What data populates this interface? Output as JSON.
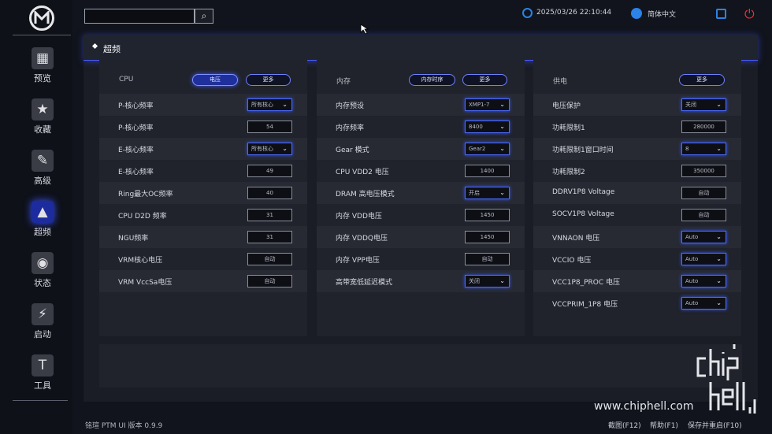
{
  "topbar": {
    "search_placeholder": "",
    "datetime": "2025/03/26 22:10:44",
    "language": "简体中文"
  },
  "sidebar": {
    "items": [
      {
        "label": "预览",
        "icon": "grid-icon"
      },
      {
        "label": "收藏",
        "icon": "star-icon"
      },
      {
        "label": "高级",
        "icon": "tools-icon"
      },
      {
        "label": "超频",
        "icon": "rocket-icon",
        "active": true
      },
      {
        "label": "状态",
        "icon": "eye-icon"
      },
      {
        "label": "启动",
        "icon": "ssd-icon"
      },
      {
        "label": "工具",
        "icon": "toolbox-icon"
      }
    ]
  },
  "page": {
    "title": "超频"
  },
  "columns": [
    {
      "header": "CPU",
      "buttons": [
        "电压",
        "更多"
      ],
      "rows": [
        {
          "label": "P-核心频率",
          "value": "所有核心",
          "type": "select"
        },
        {
          "label": "P-核心频率",
          "value": "54",
          "type": "input"
        },
        {
          "label": "E-核心频率",
          "value": "所有核心",
          "type": "select"
        },
        {
          "label": "E-核心频率",
          "value": "49",
          "type": "input"
        },
        {
          "label": "Ring最大OC频率",
          "value": "40",
          "type": "input"
        },
        {
          "label": "CPU D2D 频率",
          "value": "31",
          "type": "input"
        },
        {
          "label": "NGU频率",
          "value": "31",
          "type": "input"
        },
        {
          "label": "VRM核心电压",
          "value": "自动",
          "type": "input"
        },
        {
          "label": "VRM VccSa电压",
          "value": "自动",
          "type": "input"
        }
      ]
    },
    {
      "header": "内存",
      "buttons": [
        "内存时序",
        "更多"
      ],
      "rows": [
        {
          "label": "内存预设",
          "value": "XMP1-7",
          "type": "select"
        },
        {
          "label": "内存频率",
          "value": "8400",
          "type": "select"
        },
        {
          "label": "Gear 模式",
          "value": "Gear2",
          "type": "select"
        },
        {
          "label": "CPU VDD2 电压",
          "value": "1400",
          "type": "input"
        },
        {
          "label": "DRAM 高电压模式",
          "value": "开启",
          "type": "select"
        },
        {
          "label": "内存 VDD电压",
          "value": "1450",
          "type": "input"
        },
        {
          "label": "内存 VDDQ电压",
          "value": "1450",
          "type": "input"
        },
        {
          "label": "内存 VPP电压",
          "value": "自动",
          "type": "input"
        },
        {
          "label": "高带宽低延迟模式",
          "value": "关闭",
          "type": "select"
        }
      ]
    },
    {
      "header": "供电",
      "buttons": [
        "更多"
      ],
      "rows": [
        {
          "label": "电压保护",
          "value": "关闭",
          "type": "select"
        },
        {
          "label": "功耗限制1",
          "value": "280000",
          "type": "input"
        },
        {
          "label": "功耗限制1窗口时间",
          "value": "8",
          "type": "select"
        },
        {
          "label": "功耗限制2",
          "value": "350000",
          "type": "input"
        },
        {
          "label": "DDRV1P8 Voltage",
          "value": "自动",
          "type": "input"
        },
        {
          "label": "SOCV1P8 Voltage",
          "value": "自动",
          "type": "input"
        },
        {
          "label": "VNNAON 电压",
          "value": "Auto",
          "type": "select"
        },
        {
          "label": "VCCIO 电压",
          "value": "Auto",
          "type": "select"
        },
        {
          "label": "VCC1P8_PROC 电压",
          "value": "Auto",
          "type": "select"
        },
        {
          "label": "VCCPRIM_1P8 电压",
          "value": "Auto",
          "type": "select"
        }
      ]
    }
  ],
  "footer": {
    "version": "铭瑄 PTM UI 版本 0.9.9",
    "screenshot": "截图(F12)",
    "help": "帮助(F1)",
    "save_restart": "保存并重启(F10)"
  },
  "watermark": {
    "url": "www.chiphell.com",
    "logo_text": "chip hell"
  },
  "colors": {
    "accent_blue": "#4d6bff",
    "icon_blue": "#2c82e6",
    "power_red": "#e8333a"
  }
}
